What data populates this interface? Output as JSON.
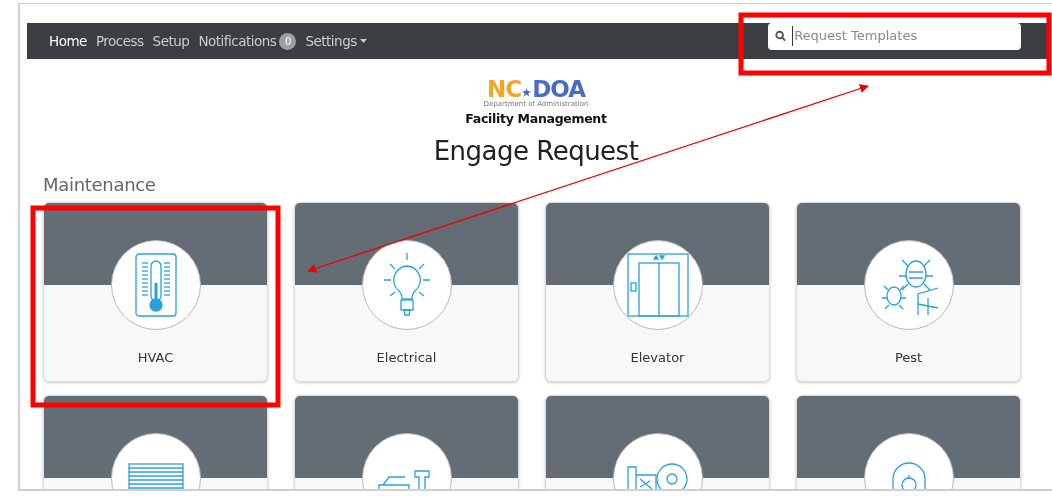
{
  "nav": {
    "items": [
      {
        "label": "Home",
        "selected": true
      },
      {
        "label": "Process",
        "selected": false
      },
      {
        "label": "Setup",
        "selected": false
      },
      {
        "label": "Notifications",
        "selected": false,
        "badge": "0"
      },
      {
        "label": "Settings",
        "selected": false,
        "dropdown": true
      }
    ],
    "search": {
      "placeholder": "Request Templates"
    }
  },
  "logo": {
    "left": "NC",
    "right": "DOA",
    "tagline": "Department of Administration",
    "subtitle": "Facility Management"
  },
  "title": "Engage Request",
  "section": "Maintenance",
  "cards": [
    {
      "label": "HVAC",
      "kind": "thermometer"
    },
    {
      "label": "Electrical",
      "kind": "bulb"
    },
    {
      "label": "Elevator",
      "kind": "elevator"
    },
    {
      "label": "Pest",
      "kind": "bug"
    },
    {
      "kind": "blinds"
    },
    {
      "kind": "tools"
    },
    {
      "kind": "machine"
    },
    {
      "kind": "doorbell"
    }
  ]
}
